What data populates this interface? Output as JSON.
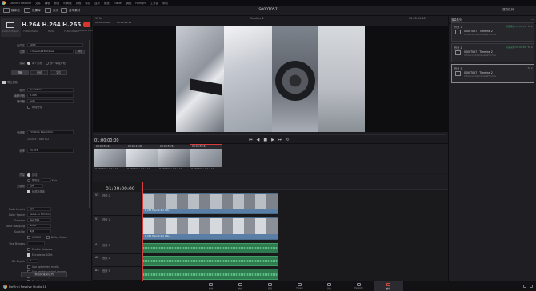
{
  "menubar": {
    "app_name": "DaVinci Resolve",
    "items": [
      "文件",
      "编辑",
      "修剪",
      "时间线",
      "片段",
      "标记",
      "显示",
      "播放",
      "Fusion",
      "调色",
      "Fairlight",
      "工作区",
      "帮助"
    ]
  },
  "toolbar": {
    "media_pool": "媒体池",
    "effects": "效果库",
    "index": "索引",
    "sound_library": "音响素材",
    "project_title": "S000T057",
    "render_queue": "渲染队列"
  },
  "left": {
    "presets": [
      {
        "big": "",
        "label": "Custom Export"
      },
      {
        "big": "H.264",
        "label": "H.264 Master"
      },
      {
        "big": "H.264",
        "label": "H.264"
      },
      {
        "big": "H.265",
        "label": "H.265 Master"
      },
      {
        "big": "",
        "label": "YouTube 1080p"
      }
    ],
    "filename_label": "文件名",
    "filename_value": "S0T0",
    "location_label": "位置",
    "location_value": "C:\\Users\\123\\Videos",
    "browse": "浏览",
    "render_label": "渲染",
    "single_clip": "单个片段",
    "individual_clips": "多个单独片段",
    "tabs": [
      "视频",
      "音频",
      "文件"
    ],
    "export_video": "导出视频",
    "format_label": "格式",
    "format_value": "QuickTime",
    "codec_label": "编解码器",
    "codec_value": "H.265",
    "encoder_label": "编码器",
    "encoder_value": "Auto",
    "network_opt": "网络优化",
    "resolution_label": "分辨率",
    "resolution_value": "Timeline Resolution",
    "res_detail": "1920 × 1080 HD",
    "framerate_label": "帧率",
    "framerate_value": "23.976",
    "quality_label": "质量",
    "quality_auto": "自动",
    "quality_limit": "限制在",
    "quality_kbps": "Kb/s",
    "keyframes_label": "关键帧",
    "keyframes_value": "自动",
    "every": "每",
    "frames": "帧",
    "frame_reorder": "帧重新排序",
    "data_levels_label": "Data Levels",
    "data_levels_value": "自动",
    "color_space_label": "Color Space",
    "color_space_value": "Same as Timeline",
    "gamma_label": "Gamma",
    "gamma_value": "Rec.709",
    "tone_label": "Tone Mapping",
    "tone_value": "None",
    "subtitle_label": "Subtitle",
    "subtitle_value": "关闭",
    "hdr10": "HDR10+",
    "dolby": "Dolby Vision",
    "enable_flat": "Enable flat pass",
    "ac_use": "Use Bypass",
    "ac_encode": "Encode as 10bit",
    "bit_depth_label": "Bit Depth",
    "bit_depth_value": "8",
    "use_gpu": "Use optimized media",
    "render_cache": "Use render cached images",
    "disable_sizing": "Disable sizing",
    "enable_flat_pass": "Enable flat pass",
    "add_to_queue": "添加到渲染队列"
  },
  "viewer": {
    "zoom": "93%",
    "timeline_name": "Timeline 2",
    "left_tc": "00:00:00:00",
    "left_tc2": "00:00:22:13",
    "right_tc": "00:05:59:43",
    "playback_tc": "01:00:00:00"
  },
  "thumbs": [
    {
      "tc": "00:09:58:22",
      "name": "H.265 Main 4:2:2 10..."
    },
    {
      "tc": "00:04:13:08",
      "name": "H.265 Main 4:2:2 10..."
    },
    {
      "tc": "00:00:59:54",
      "name": "H.265 Main 4:2:2 10..."
    },
    {
      "tc": "00:05:59:42",
      "name": "H.265 Main 4:2:2 10..."
    }
  ],
  "timeline": {
    "timecode": "01:00:00:00",
    "tracks": [
      {
        "id": "V2",
        "name": "视频 2",
        "sub": "1个片段"
      },
      {
        "id": "V1",
        "name": "视频 1",
        "sub": "1个片段"
      },
      {
        "id": "A1",
        "name": "音频 1",
        "sub": "2.0"
      },
      {
        "id": "A2",
        "name": "音频 2",
        "sub": "2.0"
      },
      {
        "id": "A3",
        "name": "音频 3",
        "sub": "2.0"
      }
    ],
    "clip_v2": "H.265 Main 4:2:2 10b...",
    "clip_v1": "H.265 Main 4:2:2 10b..."
  },
  "right": {
    "title": "渲染队列",
    "options": "···",
    "jobs": [
      {
        "id": "作业 1",
        "title": "S000T057 | Timeline 2",
        "sub": "C:/Users/123/Videos/S0T0.mov",
        "status": "渲染完成 00:00:34"
      },
      {
        "id": "作业 2",
        "title": "S000T057 | Timeline 2",
        "sub": "C:/Users/123/Videos/S0T0.mov",
        "status": "渲染完成 00:00:38"
      },
      {
        "id": "作业 3",
        "title": "S000T057 | Timeline 2",
        "sub": "C:/Users/123/Videos/S0T0.mov",
        "status": ""
      }
    ]
  },
  "bottom": {
    "brand": "DaVinci Resolve Studio 18",
    "pages": [
      "媒体",
      "快编",
      "剪辑",
      "Fusion",
      "调色",
      "Fairlight",
      "交付"
    ]
  },
  "colors": {
    "accent_red": "#d83b3b",
    "video_clip": "#5a7fa6",
    "audio_clip": "#2f7a4e"
  }
}
